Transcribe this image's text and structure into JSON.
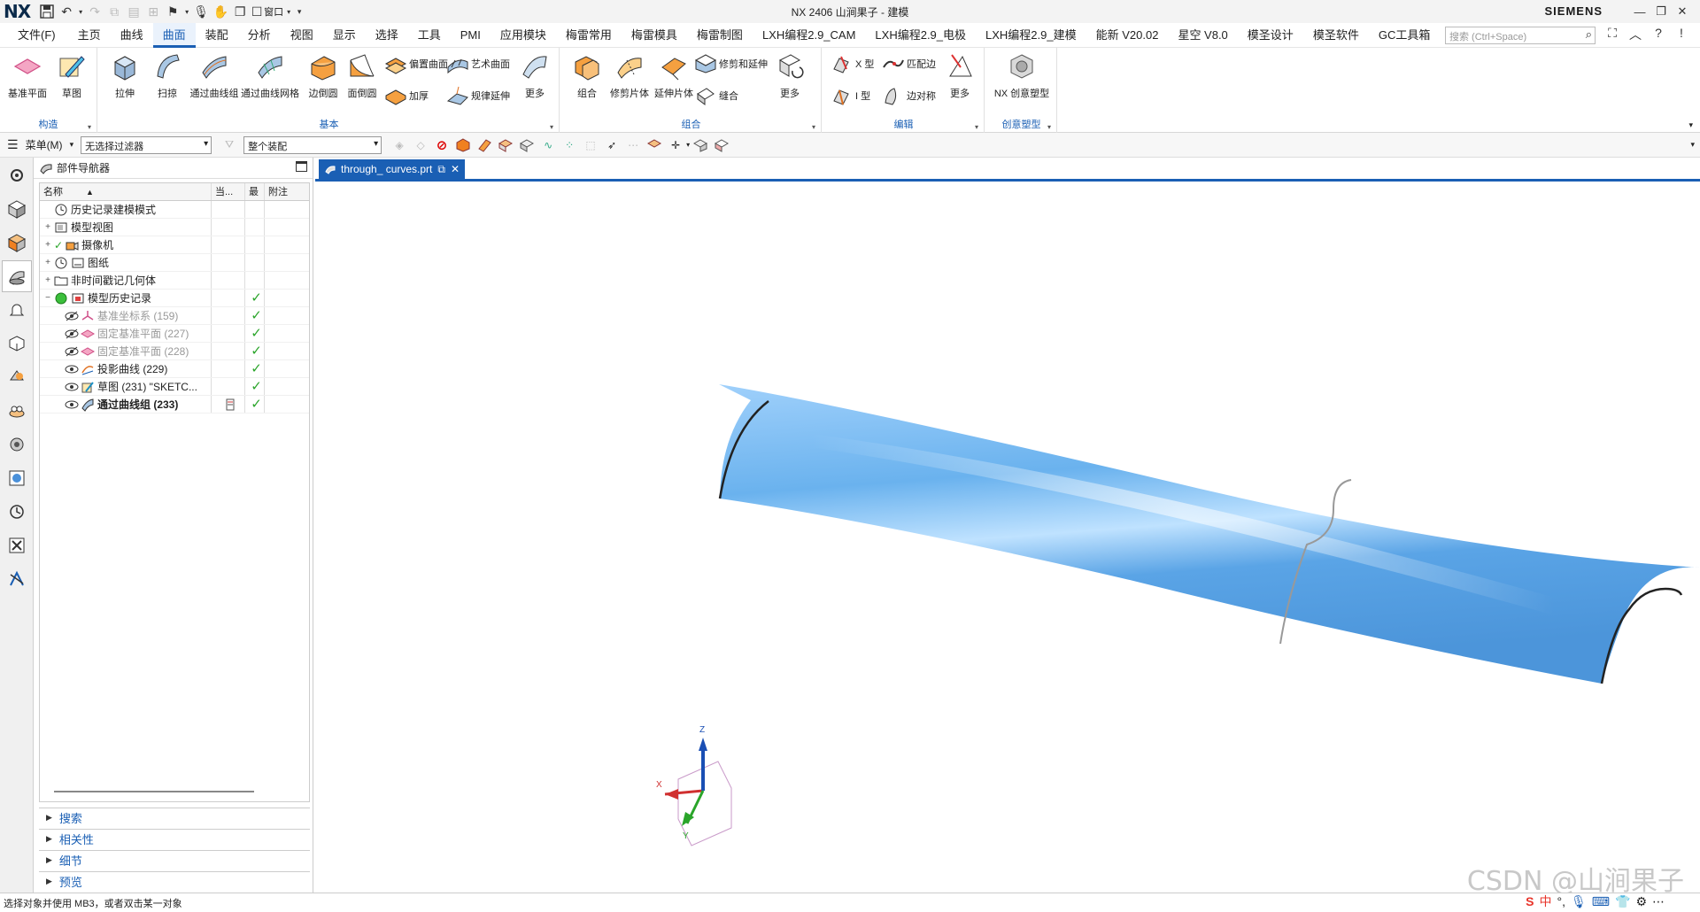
{
  "app": {
    "logo": "NX",
    "window_title": "NX 2406 山涧果子 - 建模",
    "brand": "SIEMENS"
  },
  "menubar": {
    "file": "文件(F)",
    "tabs": [
      "主页",
      "曲线",
      "曲面",
      "装配",
      "分析",
      "视图",
      "显示",
      "选择",
      "工具",
      "PMI",
      "应用模块",
      "梅雷常用",
      "梅雷模具",
      "梅雷制图",
      "LXH编程2.9_CAM",
      "LXH编程2.9_电极",
      "LXH编程2.9_建模",
      "能新 V20.02",
      "星空 V8.0",
      "模圣设计",
      "模圣软件",
      "GC工具箱"
    ],
    "active_tab": "曲面",
    "search_placeholder": "搜索 (Ctrl+Space)"
  },
  "qa": {
    "window_menu": "窗口"
  },
  "ribbon": {
    "group_construct": {
      "label": "构造",
      "datum_plane": "基准平面",
      "sketch": "草图"
    },
    "group_basic": {
      "label": "基本",
      "extrude": "拉伸",
      "sweep": "扫掠",
      "through_curves": "通过曲线组",
      "through_curve_mesh": "通过曲线网格",
      "edge_blend": "边倒圆",
      "face_blend": "面倒圆",
      "offset_surface": "偏置曲面",
      "thicken": "加厚",
      "studio_surface": "艺术曲面",
      "law_extension": "规律延伸",
      "more": "更多"
    },
    "group_combine": {
      "label": "组合",
      "unite": "组合",
      "trimmed_sheet": "修剪片体",
      "extend_sheet": "延伸片体",
      "trim_extend": "修剪和延伸",
      "sew": "缝合",
      "more": "更多"
    },
    "group_edit": {
      "label": "编辑",
      "x_form": "X 型",
      "i_form": "I 型",
      "match_edge": "匹配边",
      "edge_symmetry": "边对称",
      "more": "更多"
    },
    "group_creative": {
      "label": "创意塑型",
      "nx_realize": "NX 创意塑型"
    }
  },
  "toolbar2": {
    "menu": "菜单(M)",
    "filter": "无选择过滤器",
    "scope": "整个装配"
  },
  "navigator": {
    "title": "部件导航器",
    "columns": [
      "名称",
      "当...",
      "最",
      "附注"
    ],
    "rows": [
      {
        "label": "历史记录建模模式",
        "style": "normal",
        "check": ""
      },
      {
        "label": "模型视图",
        "style": "normal",
        "check": ""
      },
      {
        "label": "摄像机",
        "style": "normal",
        "check": ""
      },
      {
        "label": "图纸",
        "style": "normal",
        "check": ""
      },
      {
        "label": "非时间戳记几何体",
        "style": "normal",
        "check": ""
      },
      {
        "label": "模型历史记录",
        "style": "normal",
        "check": "✓"
      },
      {
        "label": "基准坐标系 (159)",
        "style": "grey",
        "check": "✓"
      },
      {
        "label": "固定基准平面 (227)",
        "style": "grey",
        "check": "✓"
      },
      {
        "label": "固定基准平面 (228)",
        "style": "grey",
        "check": "✓"
      },
      {
        "label": "投影曲线 (229)",
        "style": "normal",
        "check": "✓"
      },
      {
        "label": "草图 (231) \"SKETC...",
        "style": "normal",
        "check": "✓"
      },
      {
        "label": "通过曲线组 (233)",
        "style": "bold",
        "check": "✓"
      }
    ],
    "sections": [
      "搜索",
      "相关性",
      "细节",
      "预览"
    ]
  },
  "viewport": {
    "doc_tab": "through_ curves.prt",
    "axis_x": "X",
    "axis_y": "Y",
    "axis_z": "Z"
  },
  "statusbar": {
    "prompt": "选择对象并使用 MB3，或者双击某一对象"
  },
  "watermark": "CSDN @山涧果子",
  "ime": {
    "lang": "中"
  },
  "colors": {
    "accent": "#1a5fb4",
    "surface": "#5ea8e6",
    "check": "#2aa52a"
  }
}
